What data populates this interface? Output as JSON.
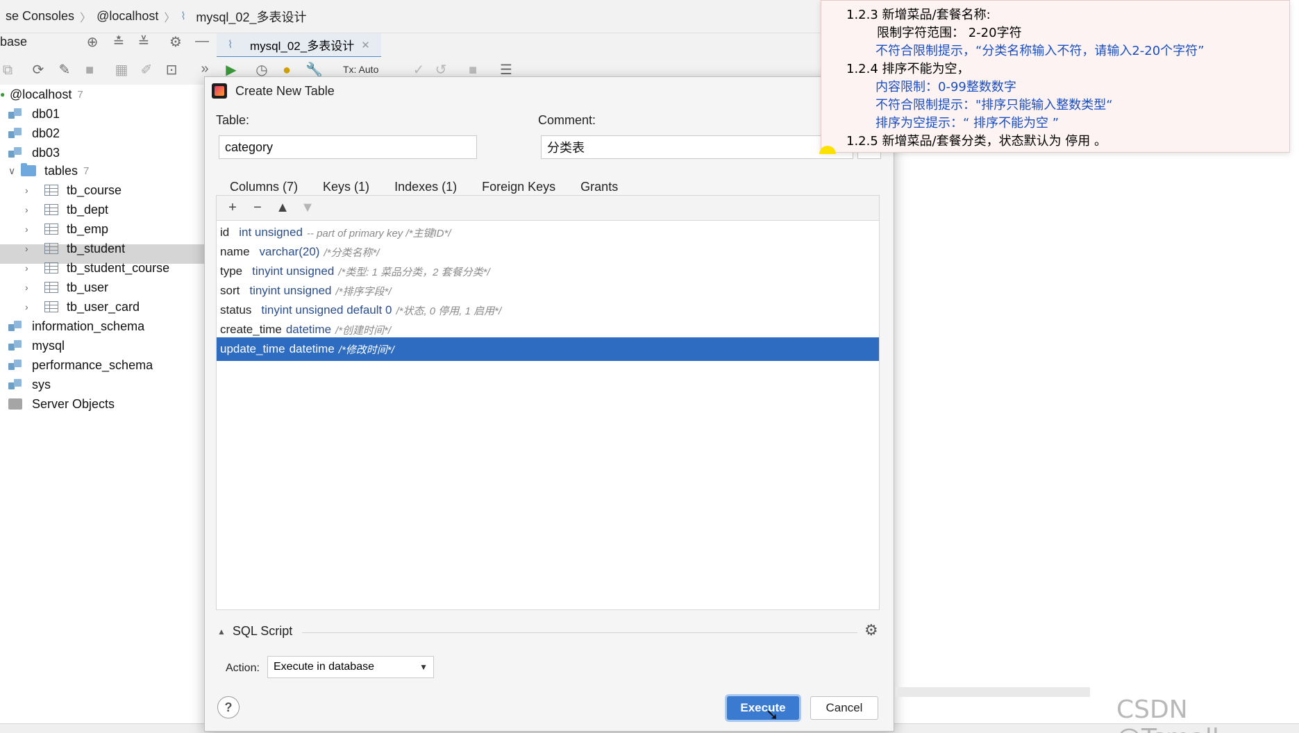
{
  "breadcrumb": [
    "se Consoles",
    "@localhost",
    "mysql_02_多表设计"
  ],
  "panel_title": "base",
  "editor_tab": {
    "label": "mysql_02_多表设计"
  },
  "toolbar": {
    "tx_mode": "Tx: Auto"
  },
  "sidebar": {
    "root": {
      "label": "@localhost",
      "count": "7"
    },
    "items": [
      {
        "label": "db01",
        "kind": "db"
      },
      {
        "label": "db02",
        "kind": "db"
      },
      {
        "label": "db03",
        "kind": "db"
      },
      {
        "label": "tables",
        "kind": "folder",
        "count": "7"
      },
      {
        "label": "tb_course",
        "kind": "table"
      },
      {
        "label": "tb_dept",
        "kind": "table"
      },
      {
        "label": "tb_emp",
        "kind": "table"
      },
      {
        "label": "tb_student",
        "kind": "table"
      },
      {
        "label": "tb_student_course",
        "kind": "table"
      },
      {
        "label": "tb_user",
        "kind": "table"
      },
      {
        "label": "tb_user_card",
        "kind": "table"
      },
      {
        "label": "information_schema",
        "kind": "db"
      },
      {
        "label": "mysql",
        "kind": "db"
      },
      {
        "label": "performance_schema",
        "kind": "db"
      },
      {
        "label": "sys",
        "kind": "db"
      },
      {
        "label": "Server Objects",
        "kind": "server"
      }
    ]
  },
  "dialog": {
    "title": "Create New Table",
    "table_label": "Table:",
    "table_value": "category",
    "comment_label": "Comment:",
    "comment_value": "分类表",
    "tabs": [
      "Columns (7)",
      "Keys (1)",
      "Indexes (1)",
      "Foreign Keys",
      "Grants"
    ],
    "columns": [
      {
        "name": "id",
        "type": "int unsigned",
        "comment": "-- part of primary key /*主键ID*/"
      },
      {
        "name": "name",
        "type": "varchar(20)",
        "comment": "/*分类名称*/"
      },
      {
        "name": "type",
        "type": "tinyint unsigned",
        "comment": "/*类型: 1 菜品分类，2 套餐分类*/"
      },
      {
        "name": "sort",
        "type": "tinyint unsigned",
        "comment": "/*排序字段*/"
      },
      {
        "name": "status",
        "type": "tinyint unsigned default 0",
        "comment": "/*状态, 0 停用, 1 启用*/"
      },
      {
        "name": "create_time",
        "type": "datetime",
        "comment": "/*创建时间*/"
      },
      {
        "name": "update_time",
        "type": "datetime",
        "comment": "/*修改时间*/"
      }
    ],
    "selected_row": 6,
    "sql_section": "SQL Script",
    "action_label": "Action:",
    "action_value": "Execute in database",
    "help_label": "?",
    "execute_label": "Execute",
    "cancel_label": "Cancel"
  },
  "notes": [
    {
      "text": "1.2.3 新增菜品/套餐名称:",
      "color": "#222222"
    },
    {
      "text": "限制字符范围： 2-20字符",
      "color": "#222222"
    },
    {
      "text": "不符合限制提示，“分类名称输入不符，请输入2-20个字符”",
      "color": "#1a4ebf"
    },
    {
      "text": "1.2.4 排序不能为空，",
      "color": "#222222"
    },
    {
      "text": "内容限制：0-99整数数字",
      "color": "#1a4ebf"
    },
    {
      "text": "不符合限制提示：\"排序只能输入整数类型“",
      "color": "#1a4ebf"
    },
    {
      "text": "排序为空提示：“ 排序不能为空 ”",
      "color": "#1a4ebf"
    },
    {
      "text": "1.2.5 新增菜品/套餐分类，状态默认为 停用 。",
      "color": "#222222"
    }
  ],
  "watermark": "CSDN @Tsmall_"
}
